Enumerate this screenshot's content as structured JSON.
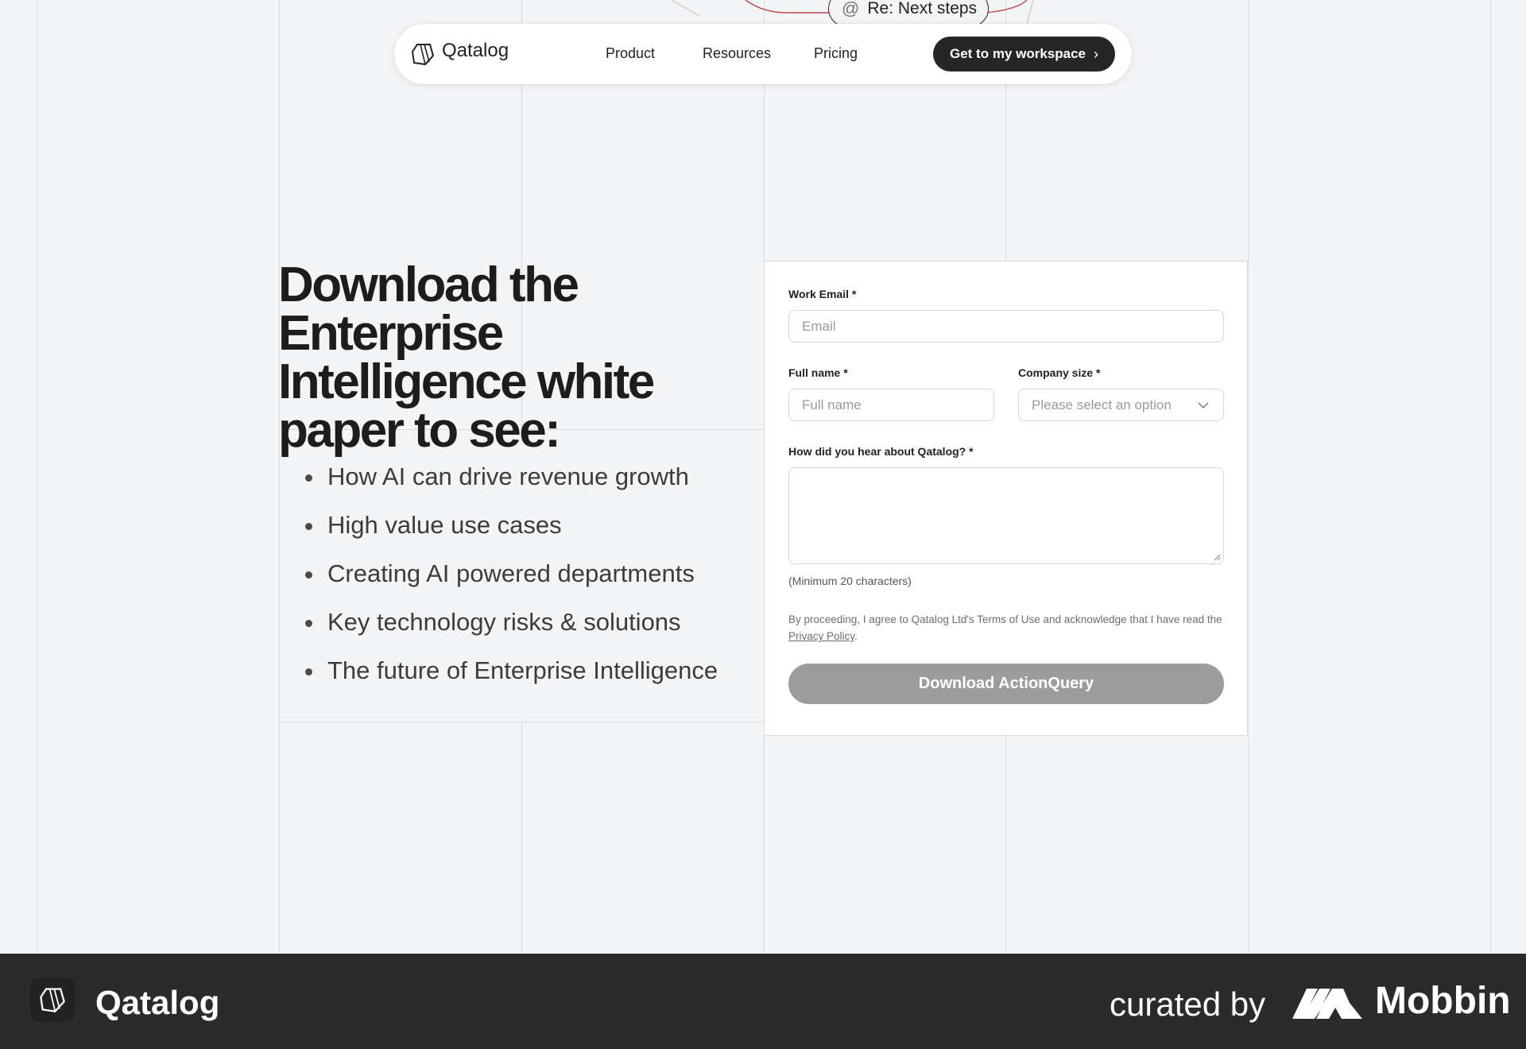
{
  "decoration": {
    "chip_label": "Re: Next steps",
    "chip_icon": "at-icon"
  },
  "nav": {
    "brand": "Qatalog",
    "links": [
      "Product",
      "Resources",
      "Pricing"
    ],
    "cta_label": "Get to my workspace"
  },
  "hero": {
    "headline": "Download the Enterprise Intelligence white paper to see:",
    "bullets": [
      "How AI can drive revenue growth",
      "High value use cases",
      "Creating AI powered departments",
      "Key technology risks & solutions",
      "The future of Enterprise Intelligence"
    ]
  },
  "form": {
    "email_label": "Work Email *",
    "email_placeholder": "Email",
    "name_label": "Full name *",
    "name_placeholder": "Full name",
    "size_label": "Company size *",
    "size_placeholder": "Please select an option",
    "source_label": "How did you hear about Qatalog? *",
    "source_hint": "(Minimum 20 characters)",
    "legal_text": "By proceeding, I agree to Qatalog Ltd's Terms of Use and acknowledge that I have read the ",
    "privacy_link": "Privacy Policy",
    "legal_end": ".",
    "submit_label": "Download ActionQuery"
  },
  "footer": {
    "brand": "Qatalog",
    "curated_by": "curated by",
    "curator": "Mobbin"
  }
}
